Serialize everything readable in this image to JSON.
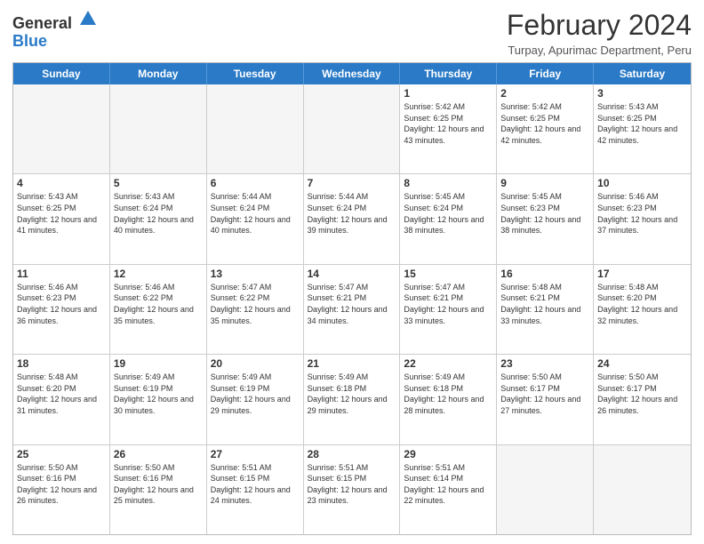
{
  "header": {
    "logo_general": "General",
    "logo_blue": "Blue",
    "month_title": "February 2024",
    "location": "Turpay, Apurimac Department, Peru"
  },
  "days_of_week": [
    "Sunday",
    "Monday",
    "Tuesday",
    "Wednesday",
    "Thursday",
    "Friday",
    "Saturday"
  ],
  "weeks": [
    [
      {
        "day": "",
        "empty": true
      },
      {
        "day": "",
        "empty": true
      },
      {
        "day": "",
        "empty": true
      },
      {
        "day": "",
        "empty": true
      },
      {
        "day": "1",
        "sunrise": "5:42 AM",
        "sunset": "6:25 PM",
        "daylight": "12 hours and 43 minutes."
      },
      {
        "day": "2",
        "sunrise": "5:42 AM",
        "sunset": "6:25 PM",
        "daylight": "12 hours and 42 minutes."
      },
      {
        "day": "3",
        "sunrise": "5:43 AM",
        "sunset": "6:25 PM",
        "daylight": "12 hours and 42 minutes."
      }
    ],
    [
      {
        "day": "4",
        "sunrise": "5:43 AM",
        "sunset": "6:25 PM",
        "daylight": "12 hours and 41 minutes."
      },
      {
        "day": "5",
        "sunrise": "5:43 AM",
        "sunset": "6:24 PM",
        "daylight": "12 hours and 40 minutes."
      },
      {
        "day": "6",
        "sunrise": "5:44 AM",
        "sunset": "6:24 PM",
        "daylight": "12 hours and 40 minutes."
      },
      {
        "day": "7",
        "sunrise": "5:44 AM",
        "sunset": "6:24 PM",
        "daylight": "12 hours and 39 minutes."
      },
      {
        "day": "8",
        "sunrise": "5:45 AM",
        "sunset": "6:24 PM",
        "daylight": "12 hours and 38 minutes."
      },
      {
        "day": "9",
        "sunrise": "5:45 AM",
        "sunset": "6:23 PM",
        "daylight": "12 hours and 38 minutes."
      },
      {
        "day": "10",
        "sunrise": "5:46 AM",
        "sunset": "6:23 PM",
        "daylight": "12 hours and 37 minutes."
      }
    ],
    [
      {
        "day": "11",
        "sunrise": "5:46 AM",
        "sunset": "6:23 PM",
        "daylight": "12 hours and 36 minutes."
      },
      {
        "day": "12",
        "sunrise": "5:46 AM",
        "sunset": "6:22 PM",
        "daylight": "12 hours and 35 minutes."
      },
      {
        "day": "13",
        "sunrise": "5:47 AM",
        "sunset": "6:22 PM",
        "daylight": "12 hours and 35 minutes."
      },
      {
        "day": "14",
        "sunrise": "5:47 AM",
        "sunset": "6:21 PM",
        "daylight": "12 hours and 34 minutes."
      },
      {
        "day": "15",
        "sunrise": "5:47 AM",
        "sunset": "6:21 PM",
        "daylight": "12 hours and 33 minutes."
      },
      {
        "day": "16",
        "sunrise": "5:48 AM",
        "sunset": "6:21 PM",
        "daylight": "12 hours and 33 minutes."
      },
      {
        "day": "17",
        "sunrise": "5:48 AM",
        "sunset": "6:20 PM",
        "daylight": "12 hours and 32 minutes."
      }
    ],
    [
      {
        "day": "18",
        "sunrise": "5:48 AM",
        "sunset": "6:20 PM",
        "daylight": "12 hours and 31 minutes."
      },
      {
        "day": "19",
        "sunrise": "5:49 AM",
        "sunset": "6:19 PM",
        "daylight": "12 hours and 30 minutes."
      },
      {
        "day": "20",
        "sunrise": "5:49 AM",
        "sunset": "6:19 PM",
        "daylight": "12 hours and 29 minutes."
      },
      {
        "day": "21",
        "sunrise": "5:49 AM",
        "sunset": "6:18 PM",
        "daylight": "12 hours and 29 minutes."
      },
      {
        "day": "22",
        "sunrise": "5:49 AM",
        "sunset": "6:18 PM",
        "daylight": "12 hours and 28 minutes."
      },
      {
        "day": "23",
        "sunrise": "5:50 AM",
        "sunset": "6:17 PM",
        "daylight": "12 hours and 27 minutes."
      },
      {
        "day": "24",
        "sunrise": "5:50 AM",
        "sunset": "6:17 PM",
        "daylight": "12 hours and 26 minutes."
      }
    ],
    [
      {
        "day": "25",
        "sunrise": "5:50 AM",
        "sunset": "6:16 PM",
        "daylight": "12 hours and 26 minutes."
      },
      {
        "day": "26",
        "sunrise": "5:50 AM",
        "sunset": "6:16 PM",
        "daylight": "12 hours and 25 minutes."
      },
      {
        "day": "27",
        "sunrise": "5:51 AM",
        "sunset": "6:15 PM",
        "daylight": "12 hours and 24 minutes."
      },
      {
        "day": "28",
        "sunrise": "5:51 AM",
        "sunset": "6:15 PM",
        "daylight": "12 hours and 23 minutes."
      },
      {
        "day": "29",
        "sunrise": "5:51 AM",
        "sunset": "6:14 PM",
        "daylight": "12 hours and 22 minutes."
      },
      {
        "day": "",
        "empty": true
      },
      {
        "day": "",
        "empty": true
      }
    ]
  ]
}
